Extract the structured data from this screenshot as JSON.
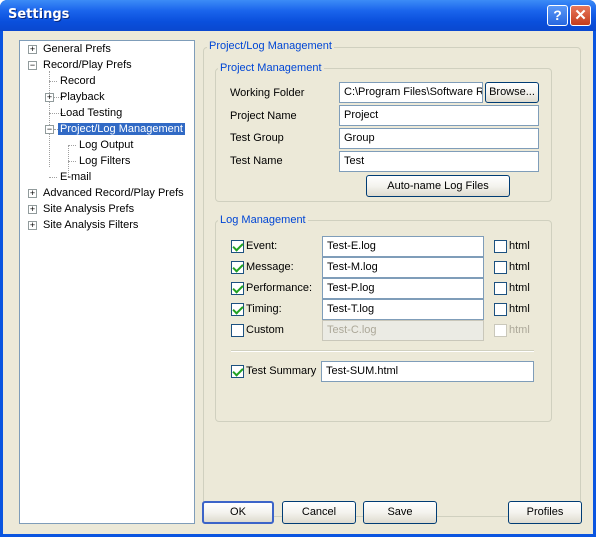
{
  "window": {
    "title": "Settings",
    "help_glyph": "?",
    "close_glyph": "✕"
  },
  "tree": {
    "items": [
      {
        "label": "General Prefs",
        "expander": "+"
      },
      {
        "label": "Record/Play Prefs",
        "expander": "−"
      },
      {
        "label": "Record",
        "expander": ""
      },
      {
        "label": "Playback",
        "expander": "+"
      },
      {
        "label": "Load Testing",
        "expander": ""
      },
      {
        "label": "Project/Log Management",
        "expander": "−",
        "selected": true
      },
      {
        "label": "Log Output",
        "expander": ""
      },
      {
        "label": "Log Filters",
        "expander": ""
      },
      {
        "label": "E-mail",
        "expander": ""
      },
      {
        "label": "Advanced Record/Play Prefs",
        "expander": "+"
      },
      {
        "label": "Site Analysis Prefs",
        "expander": "+"
      },
      {
        "label": "Site Analysis Filters",
        "expander": "+"
      }
    ]
  },
  "panel": {
    "title": "Project/Log Management",
    "project": {
      "title": "Project Management",
      "working_folder_label": "Working Folder",
      "working_folder_value": "C:\\Program Files\\Software R",
      "browse_label": "Browse...",
      "project_name_label": "Project Name",
      "project_name_value": "Project",
      "test_group_label": "Test Group",
      "test_group_value": "Group",
      "test_name_label": "Test Name",
      "test_name_value": "Test",
      "autoname_label": "Auto-name Log Files"
    },
    "log": {
      "title": "Log Management",
      "rows": [
        {
          "label": "Event:",
          "value": "Test-E.log",
          "checked": true,
          "html_label": "html"
        },
        {
          "label": "Message:",
          "value": "Test-M.log",
          "checked": true,
          "html_label": "html"
        },
        {
          "label": "Performance:",
          "value": "Test-P.log",
          "checked": true,
          "html_label": "html"
        },
        {
          "label": "Timing:",
          "value": "Test-T.log",
          "checked": true,
          "html_label": "html"
        },
        {
          "label": "Custom",
          "value": "Test-C.log",
          "checked": false,
          "disabled": true,
          "html_label": "html"
        }
      ],
      "summary_label": "Test Summary",
      "summary_value": "Test-SUM.html",
      "summary_checked": true
    }
  },
  "footer": {
    "ok": "OK",
    "cancel": "Cancel",
    "save": "Save",
    "profiles": "Profiles"
  },
  "colors": {
    "title_bar": "#1a64ec",
    "group_title": "#0046d5",
    "selection": "#316ac5",
    "dialog_bg": "#ece9d8"
  }
}
